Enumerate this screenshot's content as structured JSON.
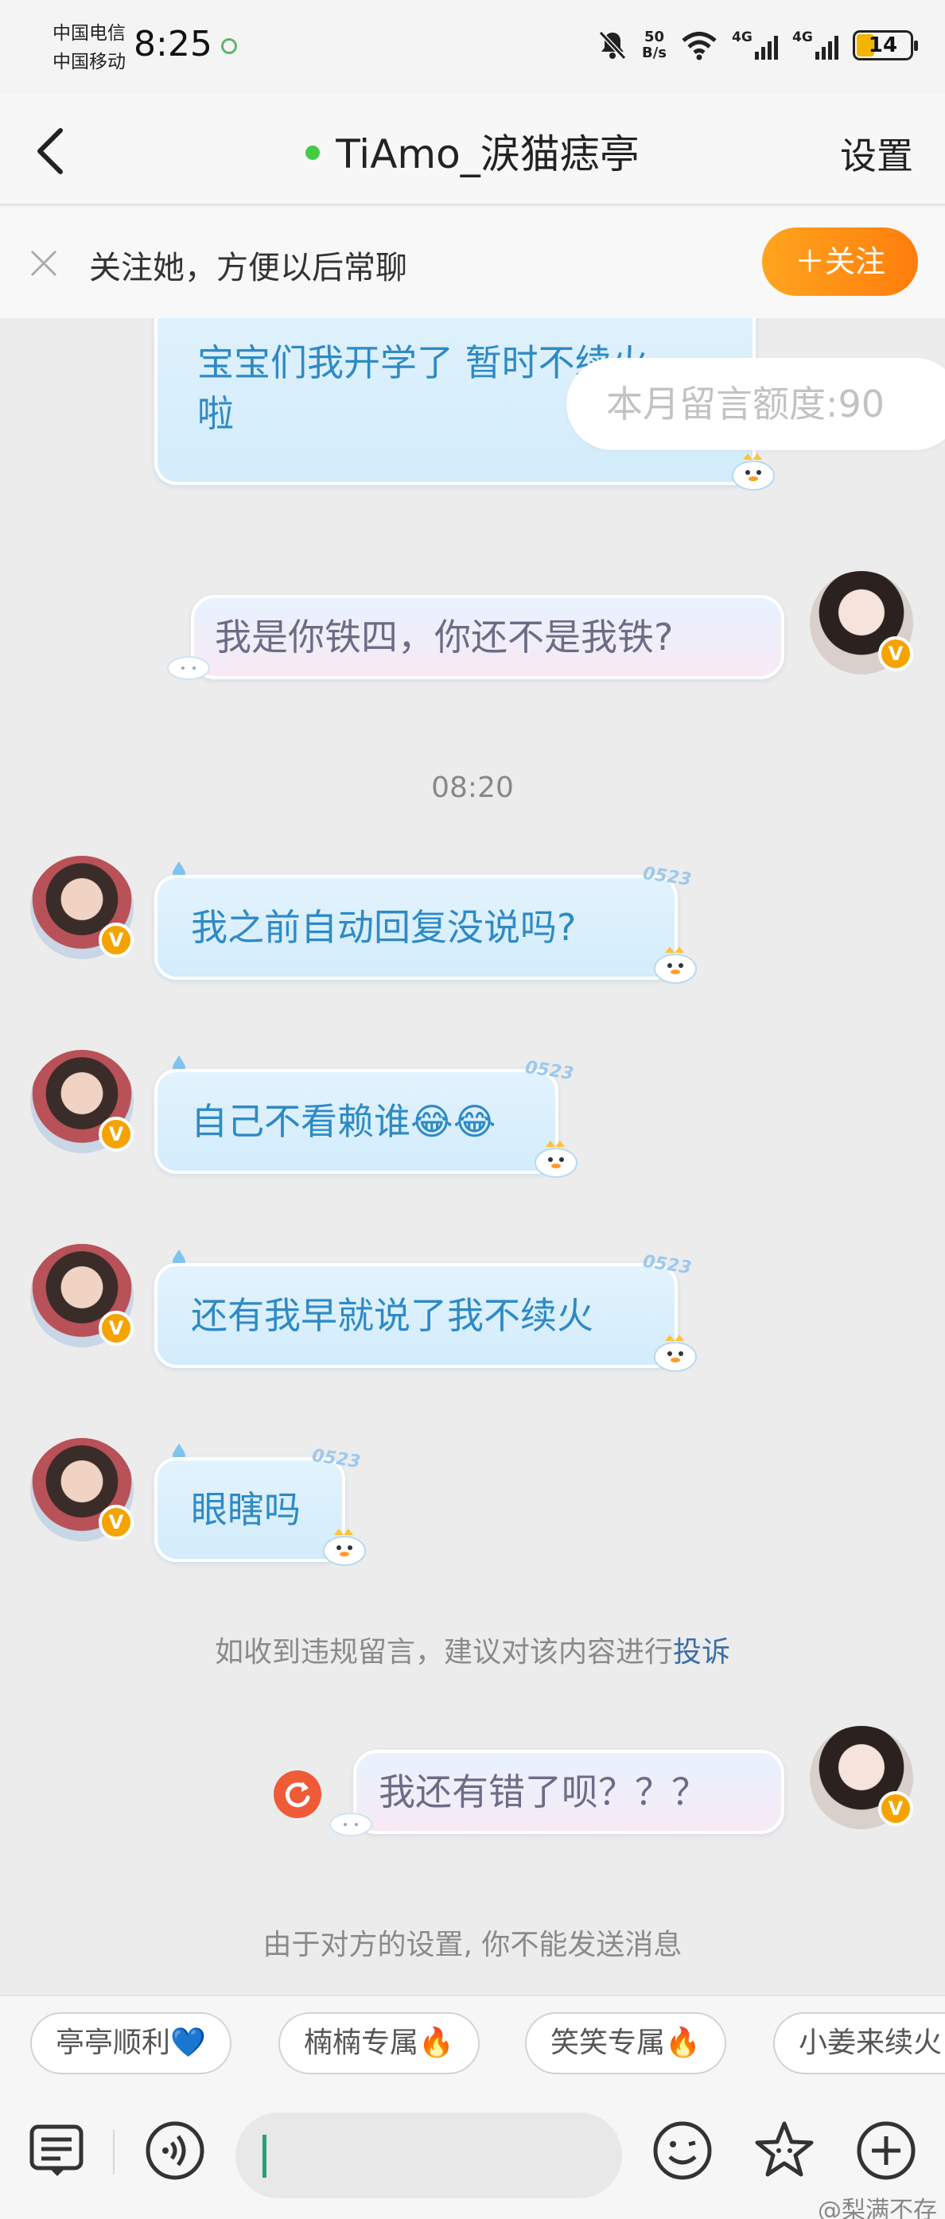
{
  "status_bar": {
    "carrier_1": "中国电信",
    "carrier_2": "中国移动",
    "time": "8:25",
    "net_speed_value": "50",
    "net_speed_unit": "B/s",
    "signal_1": "4G",
    "signal_2": "4G",
    "battery": "14",
    "battery_level_percent": 14
  },
  "header": {
    "back_icon": "chevron-left-icon",
    "title": "TiAmo_涙猫痣亭",
    "online_color": "#44cc44",
    "settings_label": "设置"
  },
  "follow_banner": {
    "close_icon": "close-icon",
    "text": "关注她，方便以后常聊",
    "button_label": "＋关注",
    "button_color": "#ff8c14"
  },
  "messages": [
    {
      "side": "left",
      "text_line_1": "宝宝们我开学了 暂时不续火",
      "text_line_2": "啦",
      "style": "blue"
    },
    {
      "side": "right",
      "text": "我是你铁四，你还不是我铁?",
      "style": "pink"
    },
    {
      "side": "left",
      "text": "我之前自动回复没说吗?",
      "style": "blue",
      "sticker_tag": "0523"
    },
    {
      "side": "left",
      "text": "自己不看赖谁😂😂",
      "style": "blue",
      "sticker_tag": "0523"
    },
    {
      "side": "left",
      "text": "还有我早就说了我不续火",
      "style": "blue",
      "sticker_tag": "0523"
    },
    {
      "side": "left",
      "text": "眼瞎吗",
      "style": "blue",
      "sticker_tag": "0523"
    },
    {
      "side": "right",
      "text": "我还有错了呗？？？",
      "style": "pink",
      "status": "failed"
    }
  ],
  "quota_popup": "本月留言额度:90",
  "timestamp": "08:20",
  "report_notice": {
    "text": "如收到违规留言，建议对该内容进行",
    "link": "投诉"
  },
  "cannot_send_notice": "由于对方的设置, 你不能发送消息",
  "quick_replies": [
    "亭亭顺利💙",
    "楠楠专属🔥",
    "笑笑专属🔥",
    "小姜来续火"
  ],
  "input_bar": {
    "icons": [
      "keyboard-list-icon",
      "voice-icon",
      "emoji-icon",
      "star-sticker-icon",
      "plus-icon"
    ]
  },
  "watermark": "@梨满不存"
}
